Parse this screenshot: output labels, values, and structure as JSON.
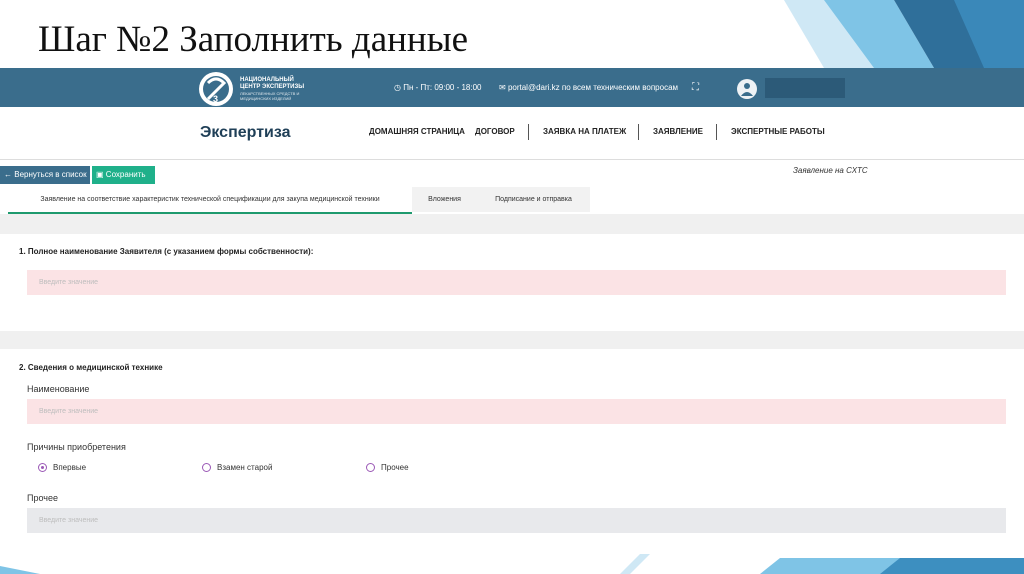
{
  "slide": {
    "title": "Шаг №2 Заполнить данные"
  },
  "topbar": {
    "org_name_line1": "НАЦИОНАЛЬНЫЙ",
    "org_name_line2": "ЦЕНТР ЭКСПЕРТИЗЫ",
    "org_name_line3": "ЛЕКАРСТВЕННЫХ СРЕДСТВ И МЕДИЦИНСКИХ ИЗДЕЛИЙ",
    "hours": "Пн - Пт: 09:00 - 18:00",
    "contact": "portal@dari.kz по всем техническим вопросам",
    "accent_color": "#3a6d8c"
  },
  "navbar": {
    "brand": "Экспертиза",
    "items": [
      {
        "label": "ДОМАШНЯЯ СТРАНИЦА"
      },
      {
        "label": "ДОГОВОР"
      },
      {
        "label": "ЗАЯВКА НА ПЛАТЕЖ"
      },
      {
        "label": "ЗАЯВЛЕНИЕ"
      },
      {
        "label": "ЭКСПЕРТНЫЕ РАБОТЫ"
      }
    ]
  },
  "toolbar": {
    "back_label": "Вернуться в список",
    "save_label": "Сохранить",
    "save_color": "#1fb08a",
    "form_type": "Заявление на СХТС"
  },
  "tabs": [
    {
      "label": "Заявление на соответствие характеристик технической спецификации для закупа медицинской техники",
      "active": true
    },
    {
      "label": "Вложения",
      "active": false
    },
    {
      "label": "Подписание и отправка",
      "active": false
    }
  ],
  "section1": {
    "title": "1. Полное наименование Заявителя (с указанием формы собственности):",
    "placeholder": "Введите значение"
  },
  "section2": {
    "title": "2. Сведения о медицинской технике",
    "name_label": "Наименование",
    "name_placeholder": "Введите значение",
    "reasons_label": "Причины приобретения",
    "reasons": [
      {
        "label": "Впервые",
        "checked": true
      },
      {
        "label": "Взамен старой",
        "checked": false
      },
      {
        "label": "Прочее",
        "checked": false
      }
    ],
    "other_label": "Прочее",
    "other_placeholder": "Введите значение",
    "error_color": "#fbe3e5"
  }
}
